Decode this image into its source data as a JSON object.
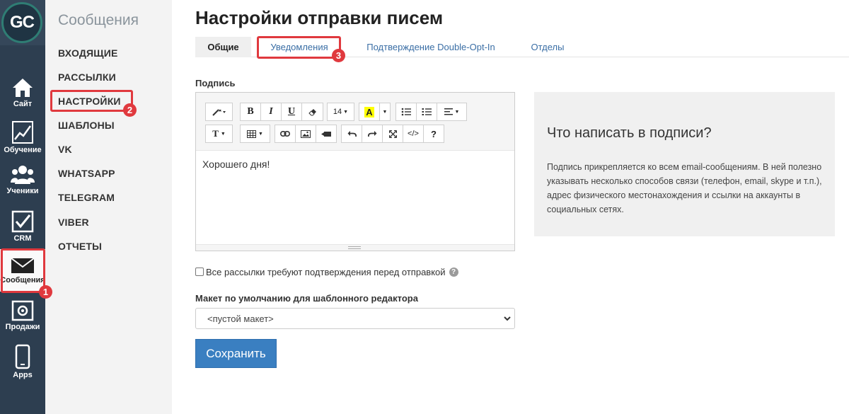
{
  "logo_text": "GC",
  "rail": {
    "items": [
      {
        "label": "Сайт",
        "icon": "home-icon"
      },
      {
        "label": "Обучение",
        "icon": "chart-icon"
      },
      {
        "label": "Ученики",
        "icon": "users-icon"
      },
      {
        "label": "CRM",
        "icon": "checkbox-icon"
      },
      {
        "label": "Сообщения",
        "icon": "envelope-icon"
      },
      {
        "label": "Продажи",
        "icon": "safe-icon"
      },
      {
        "label": "Apps",
        "icon": "phone-icon"
      }
    ]
  },
  "submenu": {
    "title": "Сообщения",
    "items": [
      {
        "label": "ВХОДЯЩИЕ"
      },
      {
        "label": "РАССЫЛКИ"
      },
      {
        "label": "НАСТРОЙКИ"
      },
      {
        "label": "ШАБЛОНЫ"
      },
      {
        "label": "VK"
      },
      {
        "label": "WHATSAPP"
      },
      {
        "label": "TELEGRAM"
      },
      {
        "label": "VIBER"
      },
      {
        "label": "ОТЧЕТЫ"
      }
    ]
  },
  "page": {
    "title": "Настройки отправки писем",
    "tabs": [
      {
        "label": "Общие"
      },
      {
        "label": "Уведомления"
      },
      {
        "label": "Подтверждение Double-Opt-In"
      },
      {
        "label": "Отделы"
      }
    ]
  },
  "signature": {
    "label": "Подпись",
    "font_size": "14",
    "content": "Хорошего дня!"
  },
  "info": {
    "title": "Что написать в подписи?",
    "text": "Подпись прикрепляется ко всем email-сообщениям. В ней полезно указывать несколько способов связи (телефон, email, skype и т.п.), адрес физического местонахождения и ссылки на аккаунты в социальных сетях."
  },
  "confirm_checkbox": {
    "label": "Все рассылки требуют подтверждения перед отправкой",
    "checked": false,
    "help": "?"
  },
  "template_layout": {
    "label": "Макет по умолчанию для шаблонного редактора",
    "value": "<пустой макет>"
  },
  "save_label": "Сохранить",
  "annotations": {
    "badge1": "1",
    "badge2": "2",
    "badge3": "3",
    "color": "#e0393e"
  }
}
